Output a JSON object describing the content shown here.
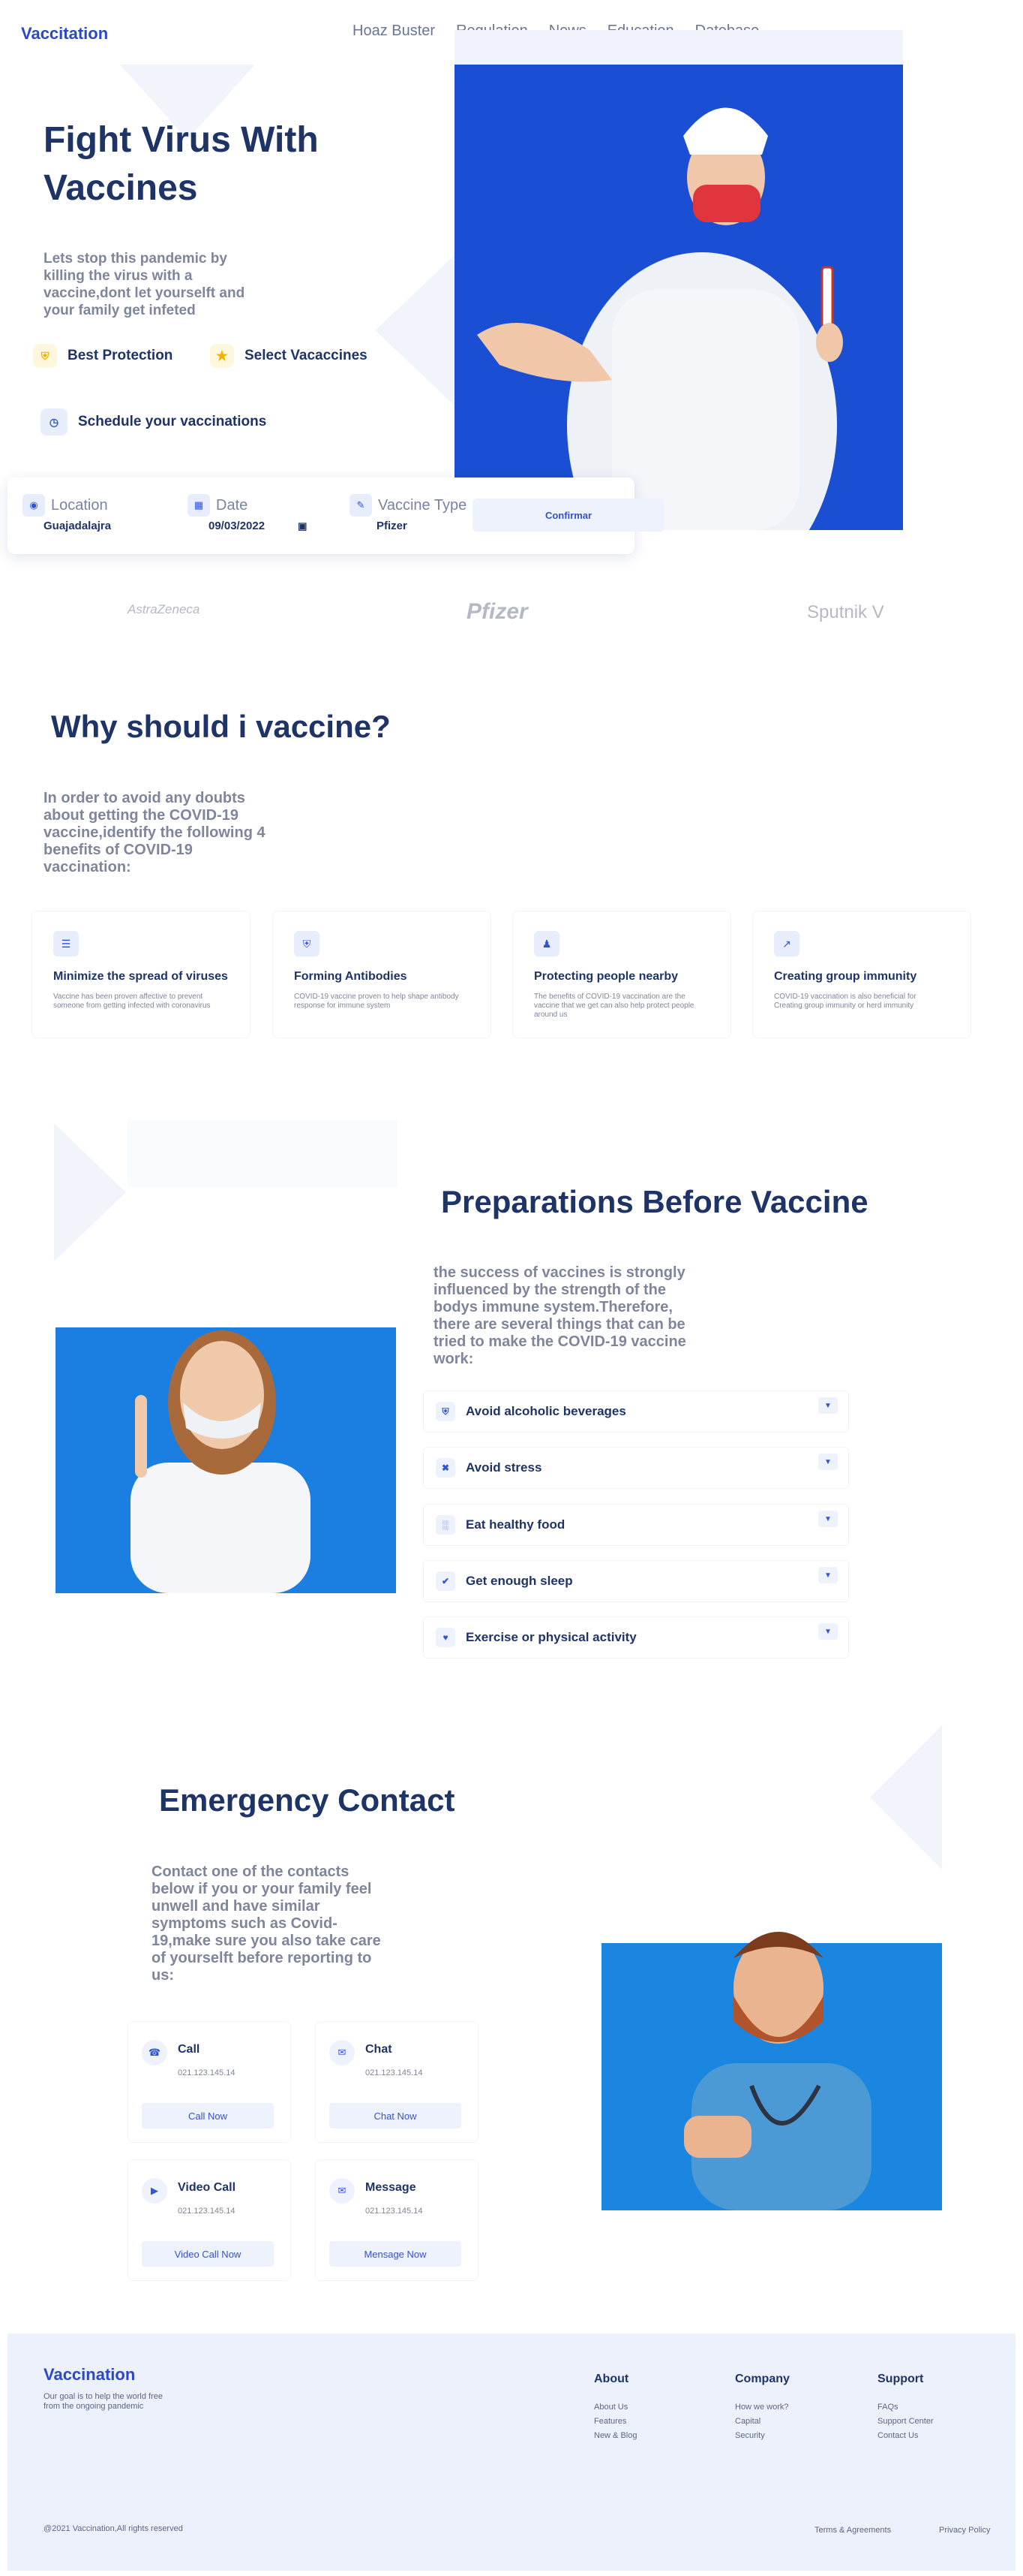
{
  "brand": "Vaccitation",
  "nav": [
    "Hoaz Buster",
    "Regulation",
    "News",
    "Education",
    "Datebase"
  ],
  "hero": {
    "title_line1": "Fight Virus With",
    "title_line2": "Vaccines",
    "subtitle": "Lets stop this pandemic by killing the virus with a vaccine,dont let yourselft and your family get infeted",
    "chip1": "Best Protection",
    "chip2": "Select Vacaccines",
    "schedule": "Schedule your vaccinations"
  },
  "booking": {
    "location_label": "Location",
    "location_value": "Guajadalajra",
    "date_label": "Date",
    "date_value": "09/03/2022",
    "type_label": "Vaccine Type",
    "type_value": "Pfizer",
    "confirm": "Confirmar"
  },
  "partners": [
    "AstraZeneca",
    "Pfizer",
    "Sputnik V"
  ],
  "why": {
    "title": "Why should i vaccine?",
    "text": "In order to avoid any doubts about getting the COVID-19 vaccine,identify the following 4 benefits of COVID-19 vaccination:",
    "cards": [
      {
        "title": "Minimize the spread of viruses",
        "desc": "Vaccine has been proven affective to prevent someone from getting infected with coronavirus",
        "icon": "sliders-icon"
      },
      {
        "title": "Forming Antibodies",
        "desc": "COVID-19 vaccine proven to help shape antibody response for immune system",
        "icon": "shield-icon"
      },
      {
        "title": "Protecting people nearby",
        "desc": "The benefits of COVID-19 vaccination are the vaccine that we get can also help protect people around us",
        "icon": "people-icon"
      },
      {
        "title": "Creating group immunity",
        "desc": "COVID-19 vaccination is also beneficial for Creating group immunity or herd immunity",
        "icon": "chart-icon"
      }
    ]
  },
  "prep": {
    "title": "Preparations Before Vaccine",
    "text": "the success of vaccines is strongly influenced by the strength of the bodys immune system.Therefore, there are several things that can be tried to make the COVID-19 vaccine work:",
    "items": [
      "Avoid alcoholic beverages",
      "Avoid stress",
      "Eat healthy food",
      "Get enough sleep",
      "Exercise or physical activity"
    ]
  },
  "emergency": {
    "title": "Emergency Contact",
    "text": "Contact one of the contacts below if you or your family feel unwell and have similar symptoms such as Covid-19,make sure you also take care of yourselft before reporting to us:",
    "cards": [
      {
        "title": "Call",
        "number": "021.123.145.14",
        "button": "Call Now"
      },
      {
        "title": "Chat",
        "number": "021.123.145.14",
        "button": "Chat Now"
      },
      {
        "title": "Video Call",
        "number": "021.123.145.14",
        "button": "Video Call Now"
      },
      {
        "title": "Message",
        "number": "021.123.145.14",
        "button": "Mensage Now"
      }
    ]
  },
  "footer": {
    "brand": "Vaccination",
    "tagline": "Our goal is to help the world free from the ongoing pandemic",
    "about_title": "About",
    "about": [
      "About Us",
      "Features",
      "New & Blog"
    ],
    "company_title": "Company",
    "company": [
      "How we work?",
      "Capital",
      "Security"
    ],
    "support_title": "Support",
    "support": [
      "FAQs",
      "Support Center",
      "Contact Us"
    ],
    "copyright": "@2021 Vaccination,All rights reserved",
    "terms": "Terms & Agreements",
    "privacy": "Privacy Policy"
  },
  "colors": {
    "accent": "#2b49c7",
    "navy": "#1f3466",
    "muted": "#7f859a",
    "panel": "#edf1fc",
    "photo_blue": "#1a4fd3"
  }
}
